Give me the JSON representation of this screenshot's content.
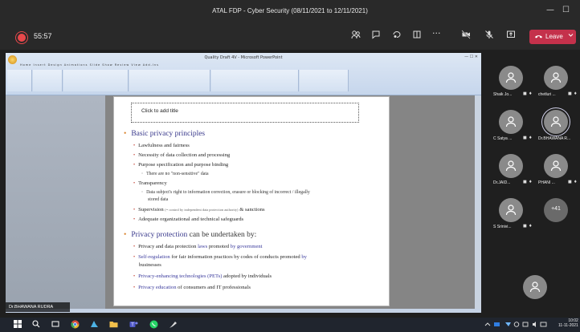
{
  "window": {
    "title": "ATAL FDP - Cyber Security (08/11/2021 to 12/11/2021)",
    "minimize_glyph": "—",
    "maximize_glyph": "☐"
  },
  "meeting_toolbar": {
    "timer": "55:57",
    "more_glyph": "···",
    "leave_label": "Leave",
    "leave_color": "#c4314b",
    "icons": [
      "participants-icon",
      "chat-icon",
      "reactions-icon",
      "rooms-icon",
      "more-icon",
      "camera-off-icon",
      "mic-off-icon",
      "share-icon"
    ]
  },
  "shared_screen": {
    "ppt_title": "Quality Draft 4V - Microsoft PowerPoint",
    "ribbon_tabs": "Home Insert Design Animations Slide Show Review View Add-Ins",
    "slide": {
      "title_placeholder": "Click to add title",
      "sections": [
        {
          "heading": "Basic privacy principles",
          "items": [
            "Lawfulness and fairness",
            "Necessity of data collection and processing",
            "Purpose specification and purpose binding",
            "There are no \"non-sensitive\" data",
            "Transparency",
            "Data subject's right to information correction, erasure or blocking of incorrect / illegally",
            "stored data",
            "Supervision",
            "(= control by independent data protection authority)",
            "& sanctions",
            "Adequate organizational and technical safeguards"
          ]
        },
        {
          "heading_a": "Privacy protection",
          "heading_b": " can be undertaken by:",
          "items": [
            "Privacy and data protection ",
            "laws",
            " promoted ",
            "by government",
            "Self-regulation",
            " for fair information practices by codes of conducts promoted ",
            "by",
            "businesses",
            "Privacy-enhancing technologies (PETs)",
            " adopted by individuals",
            "Privacy education",
            " of consumers and IT professionals"
          ]
        }
      ]
    }
  },
  "speaker_label": "Dr.BHAWANA RUDRA",
  "participants": [
    {
      "name": "Shaik Jo..."
    },
    {
      "name": "chetluri ..."
    },
    {
      "name": "C Satya ..."
    },
    {
      "name": "Dr.BHAWANA R..."
    },
    {
      "name": "Dr.JAID..."
    },
    {
      "name": "PHANI ..."
    },
    {
      "name": "S Srinivi..."
    }
  ],
  "more_participants": "+41",
  "taskbar": {
    "time": "10:02",
    "date": "11-11-2021"
  }
}
